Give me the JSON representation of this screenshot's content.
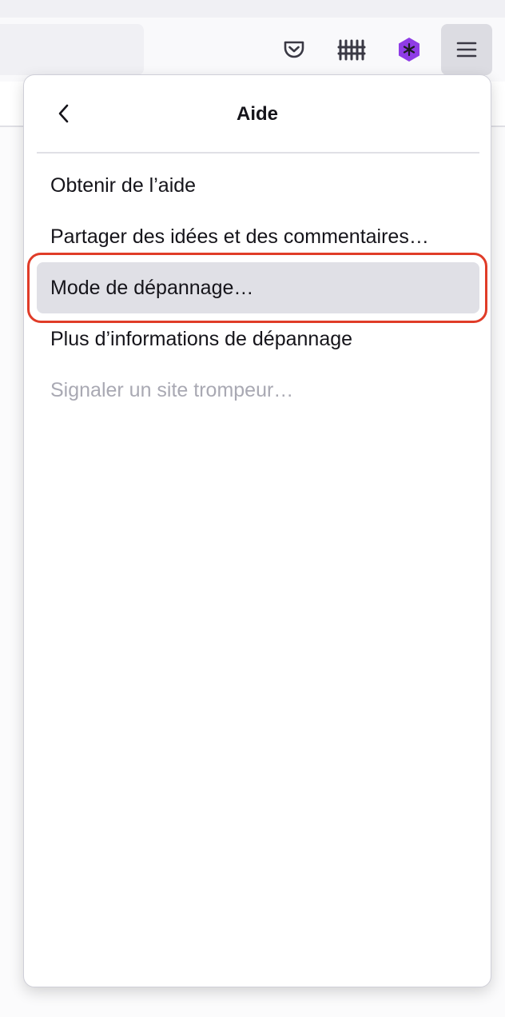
{
  "toolbar": {
    "icons": [
      "pocket-icon",
      "library-icon",
      "extension-icon",
      "hamburger-menu-icon"
    ],
    "colors": {
      "extension_accent": "#8f3ce6",
      "icon_stroke": "#3a3944",
      "active_button_bg": "#dcdce2"
    }
  },
  "panel": {
    "title": "Aide",
    "back_icon": "chevron-left-icon",
    "items": [
      {
        "label": "Obtenir de l’aide",
        "state": "normal"
      },
      {
        "label": "Partager des idées et des commentaires…",
        "state": "normal"
      },
      {
        "label": "Mode de dépannage…",
        "state": "hovered"
      },
      {
        "label": "Plus d’informations de dépannage",
        "state": "normal"
      },
      {
        "label": "Signaler un site trompeur…",
        "state": "disabled"
      }
    ]
  },
  "annotation": {
    "highlight_color": "#e03c28",
    "highlighted_item": "Mode de dépannage…"
  }
}
